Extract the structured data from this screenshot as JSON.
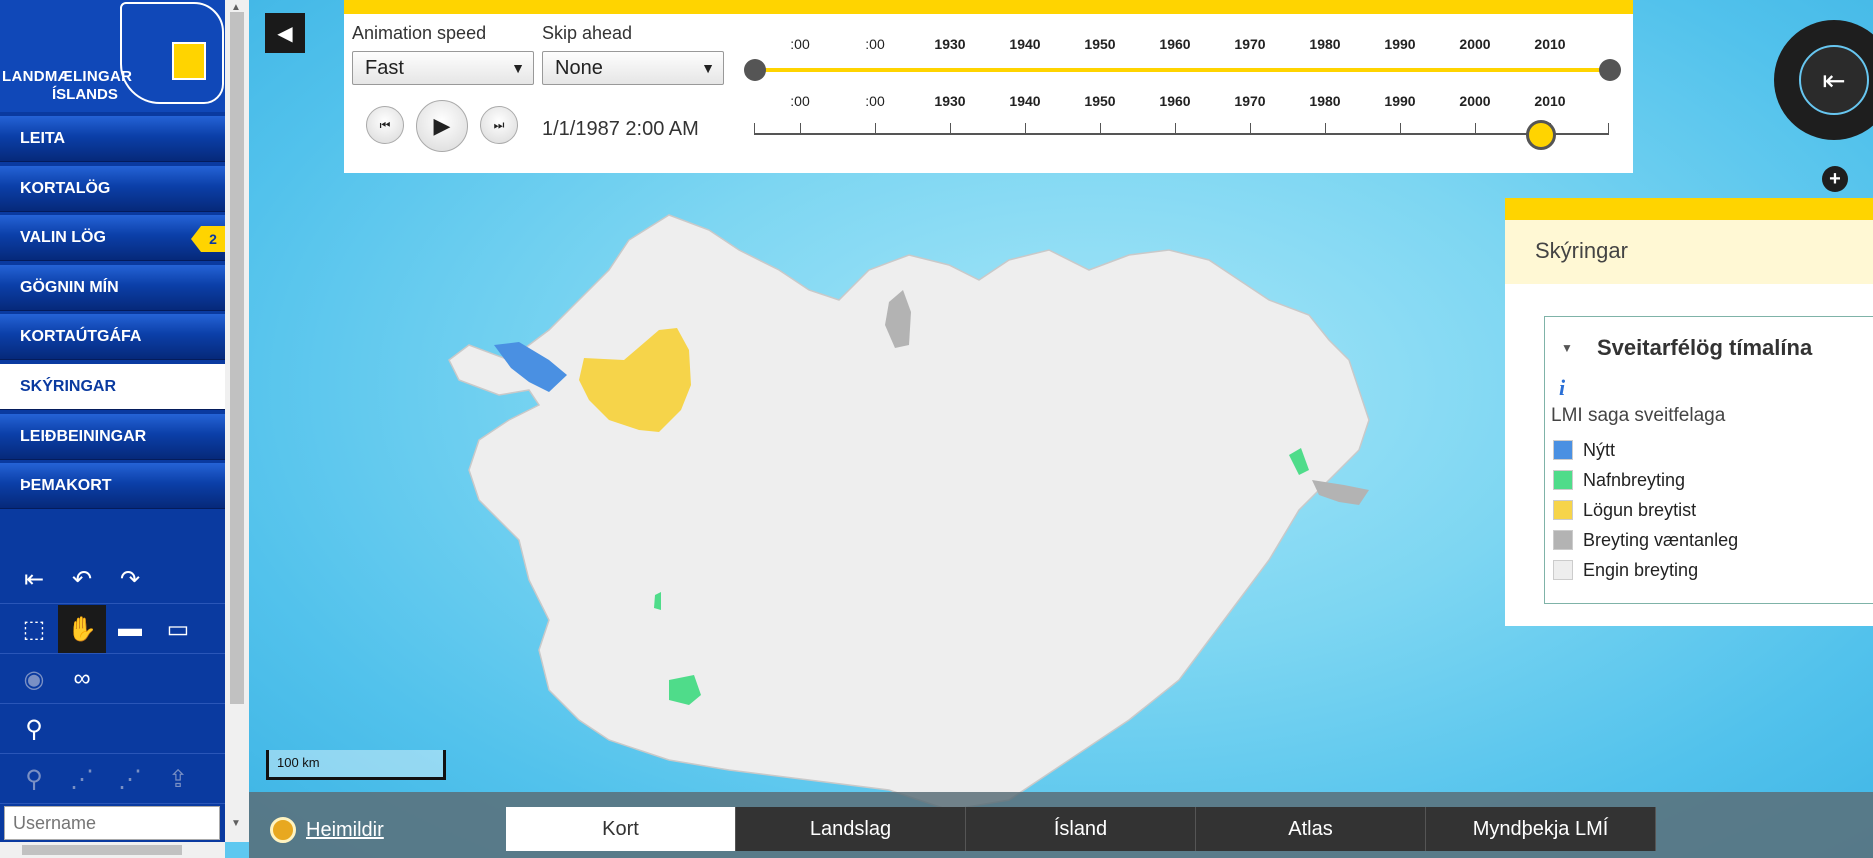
{
  "brand": {
    "line1": "LANDMÆLINGAR",
    "line2": "ÍSLANDS"
  },
  "sidebar": {
    "items": [
      {
        "label": "LEITA"
      },
      {
        "label": "KORTALÖG"
      },
      {
        "label": "VALIN LÖG",
        "badge": "2"
      },
      {
        "label": "GÖGNIN MÍN"
      },
      {
        "label": "KORTAÚTGÁFA"
      },
      {
        "label": "SKÝRINGAR",
        "active": true
      },
      {
        "label": "LEIÐBEININGAR"
      },
      {
        "label": "ÞEMAKORT"
      }
    ],
    "username_placeholder": "Username"
  },
  "timeslider": {
    "speed_label": "Animation speed",
    "speed_value": "Fast",
    "skip_label": "Skip ahead",
    "skip_value": "None",
    "current_time": "1/1/1987 2:00 AM",
    "ticks": [
      ":00",
      ":00",
      "1930",
      "1940",
      "1950",
      "1960",
      "1970",
      "1980",
      "1990",
      "2000",
      "2010"
    ],
    "current_fraction": 0.92
  },
  "legend": {
    "header": "Skýringar",
    "group_title": "Sveitarfélög tímalína",
    "info": "i",
    "subtitle": "LMI saga sveitfelaga",
    "items": [
      {
        "label": "Nýtt",
        "color": "#4a90e2"
      },
      {
        "label": "Nafnbreyting",
        "color": "#4fdc8a"
      },
      {
        "label": "Lögun breytist",
        "color": "#f6d44a"
      },
      {
        "label": "Breyting væntanleg",
        "color": "#b3b3b3"
      },
      {
        "label": "Engin breyting",
        "color": "#eeeeee"
      }
    ]
  },
  "map": {
    "scale": "100 km",
    "attribution": "Heimildir",
    "basemaps": [
      "Kort",
      "Landslag",
      "Ísland",
      "Atlas",
      "Myndþekja LMÍ"
    ],
    "active_basemap": "Kort"
  },
  "colors": {
    "accent": "#ffd400",
    "sidebar": "#0a3aa0"
  }
}
